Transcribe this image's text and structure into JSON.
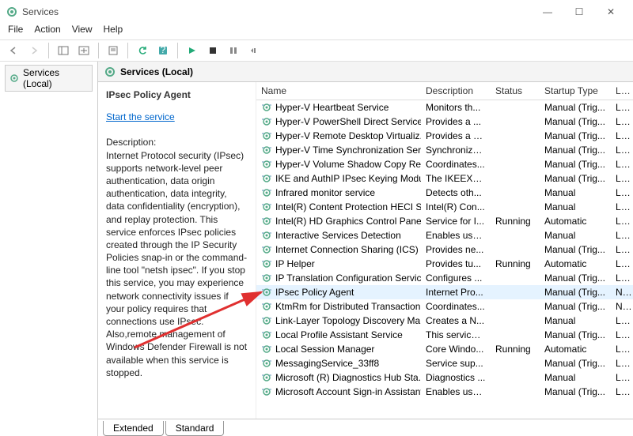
{
  "window": {
    "title": "Services",
    "min": "—",
    "max": "☐",
    "close": "✕"
  },
  "menu": {
    "file": "File",
    "action": "Action",
    "view": "View",
    "help": "Help"
  },
  "tree": {
    "root": "Services (Local)"
  },
  "pane": {
    "header": "Services (Local)"
  },
  "detail": {
    "title": "IPsec Policy Agent",
    "start_link": "Start the service",
    "desc_label": "Description:",
    "desc": "Internet Protocol security (IPsec) supports network-level peer authentication, data origin authentication, data integrity, data confidentiality (encryption), and replay protection.  This service enforces IPsec policies created through the IP Security Policies snap-in or the command-line tool \"netsh ipsec\".  If you stop this service, you may experience network connectivity issues if your policy requires that connections use IPsec.  Also,remote management of Windows Defender Firewall is not available when this service is stopped."
  },
  "columns": {
    "name": "Name",
    "desc": "Description",
    "status": "Status",
    "startup": "Startup Type",
    "logon": "Log"
  },
  "services": [
    {
      "name": "Hyper-V Heartbeat Service",
      "desc": "Monitors th...",
      "status": "",
      "startup": "Manual (Trig...",
      "logon": "Loc"
    },
    {
      "name": "Hyper-V PowerShell Direct Service",
      "desc": "Provides a ...",
      "status": "",
      "startup": "Manual (Trig...",
      "logon": "Loc"
    },
    {
      "name": "Hyper-V Remote Desktop Virtualiz...",
      "desc": "Provides a p...",
      "status": "",
      "startup": "Manual (Trig...",
      "logon": "Loc"
    },
    {
      "name": "Hyper-V Time Synchronization Serv...",
      "desc": "Synchronize...",
      "status": "",
      "startup": "Manual (Trig...",
      "logon": "Loc"
    },
    {
      "name": "Hyper-V Volume Shadow Copy Re...",
      "desc": "Coordinates...",
      "status": "",
      "startup": "Manual (Trig...",
      "logon": "Loc"
    },
    {
      "name": "IKE and AuthIP IPsec Keying Modu...",
      "desc": "The IKEEXT ...",
      "status": "",
      "startup": "Manual (Trig...",
      "logon": "Loc"
    },
    {
      "name": "Infrared monitor service",
      "desc": "Detects oth...",
      "status": "",
      "startup": "Manual",
      "logon": "Loc"
    },
    {
      "name": "Intel(R) Content Protection HECI S...",
      "desc": "Intel(R) Con...",
      "status": "",
      "startup": "Manual",
      "logon": "Loc"
    },
    {
      "name": "Intel(R) HD Graphics Control Panel...",
      "desc": "Service for I...",
      "status": "Running",
      "startup": "Automatic",
      "logon": "Loc"
    },
    {
      "name": "Interactive Services Detection",
      "desc": "Enables use...",
      "status": "",
      "startup": "Manual",
      "logon": "Loc"
    },
    {
      "name": "Internet Connection Sharing (ICS)",
      "desc": "Provides ne...",
      "status": "",
      "startup": "Manual (Trig...",
      "logon": "Loc"
    },
    {
      "name": "IP Helper",
      "desc": "Provides tu...",
      "status": "Running",
      "startup": "Automatic",
      "logon": "Loc"
    },
    {
      "name": "IP Translation Configuration Service",
      "desc": "Configures ...",
      "status": "",
      "startup": "Manual (Trig...",
      "logon": "Loc"
    },
    {
      "name": "IPsec Policy Agent",
      "desc": "Internet Pro...",
      "status": "",
      "startup": "Manual (Trig...",
      "logon": "Net",
      "selected": true
    },
    {
      "name": "KtmRm for Distributed Transaction...",
      "desc": "Coordinates...",
      "status": "",
      "startup": "Manual (Trig...",
      "logon": "Net"
    },
    {
      "name": "Link-Layer Topology Discovery Ma...",
      "desc": "Creates a N...",
      "status": "",
      "startup": "Manual",
      "logon": "Loc"
    },
    {
      "name": "Local Profile Assistant Service",
      "desc": "This service ...",
      "status": "",
      "startup": "Manual (Trig...",
      "logon": "Loc"
    },
    {
      "name": "Local Session Manager",
      "desc": "Core Windo...",
      "status": "Running",
      "startup": "Automatic",
      "logon": "Loc"
    },
    {
      "name": "MessagingService_33ff8",
      "desc": "Service sup...",
      "status": "",
      "startup": "Manual (Trig...",
      "logon": "Loc"
    },
    {
      "name": "Microsoft (R) Diagnostics Hub Sta...",
      "desc": "Diagnostics ...",
      "status": "",
      "startup": "Manual",
      "logon": "Loc"
    },
    {
      "name": "Microsoft Account Sign-in Assistant",
      "desc": "Enables use...",
      "status": "",
      "startup": "Manual (Trig...",
      "logon": "Loc"
    }
  ],
  "tabs": {
    "extended": "Extended",
    "standard": "Standard"
  }
}
